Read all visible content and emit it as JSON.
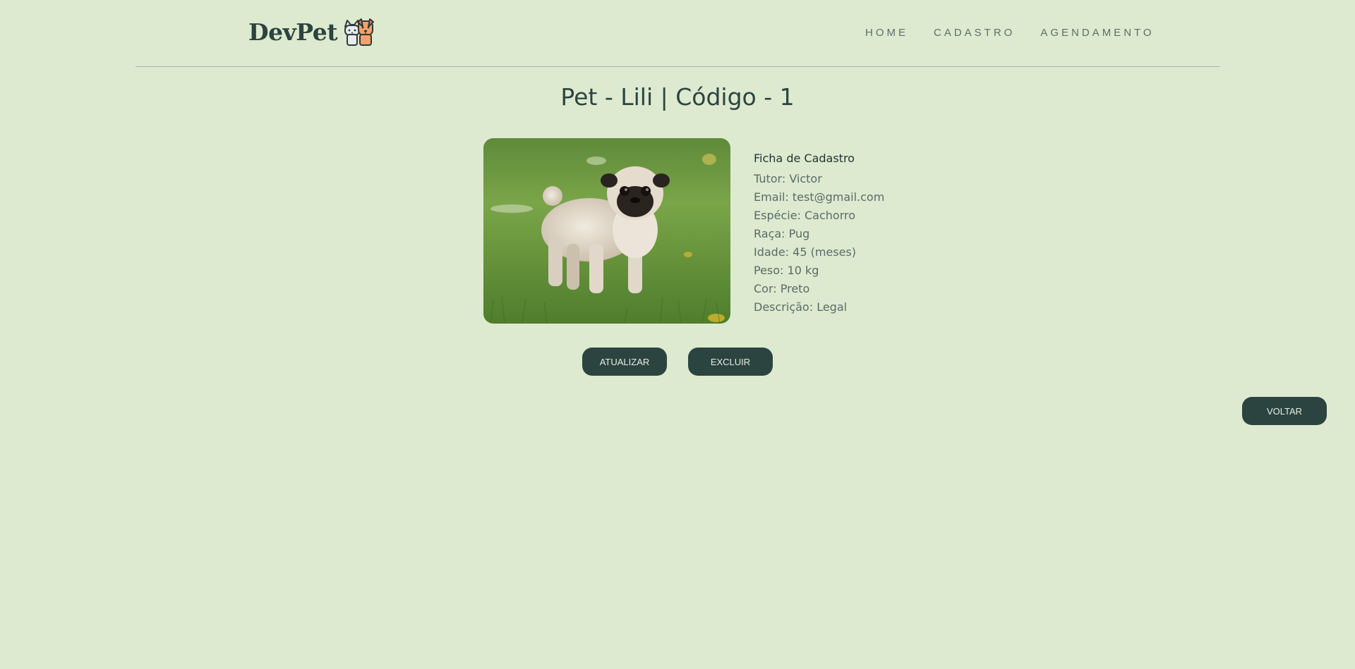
{
  "brand": {
    "name": "DevPet",
    "logo_icon": "cat-and-dog-icon"
  },
  "nav": {
    "items": [
      {
        "label": "HOME"
      },
      {
        "label": "CADASTRO"
      },
      {
        "label": "AGENDAMENTO"
      }
    ]
  },
  "pet": {
    "title": "Pet - Lili | Código - 1",
    "photo_alt": "pug-photo",
    "card": {
      "heading": "Ficha de Cadastro",
      "rows": [
        "Tutor: Victor",
        "Email: test@gmail.com",
        "Espécie: Cachorro",
        "Raça: Pug",
        "Idade: 45 (meses)",
        "Peso: 10 kg",
        "Cor: Preto",
        "Descrição: Legal"
      ]
    }
  },
  "actions": {
    "update_label": "ATUALIZAR",
    "delete_label": "EXCLUIR",
    "back_label": "VOLTAR"
  },
  "colors": {
    "background": "#ddead0",
    "primary": "#2c4440",
    "nav_text": "#5c6e68"
  }
}
